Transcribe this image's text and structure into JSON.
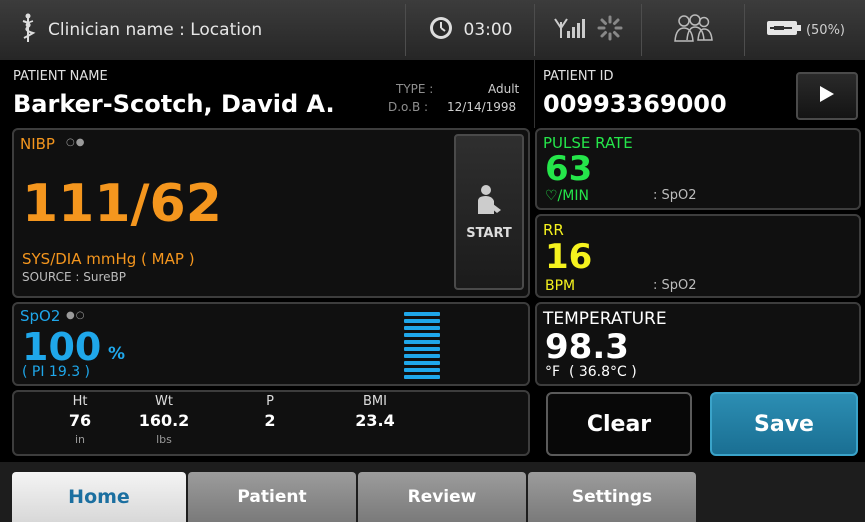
{
  "status_bar": {
    "clinician_location": "Clinician name : Location",
    "time": "03:00",
    "battery_percent": "(50%)",
    "icons": [
      "caduceus-icon",
      "clock-icon",
      "signal-icon",
      "sync-icon",
      "users-icon",
      "battery-icon"
    ]
  },
  "patient": {
    "name_label": "PATIENT NAME",
    "name": "Barker-Scotch, David A.",
    "type_label": "TYPE :",
    "type": "Adult",
    "dob_label": "D.o.B :",
    "dob": "12/14/1998",
    "id_label": "PATIENT ID",
    "id": "00993369000"
  },
  "nibp": {
    "label": "NIBP",
    "value": "111/62",
    "units": "SYS/DIA mmHg ( MAP )",
    "source": "SOURCE : SureBP",
    "start_label": "START",
    "color": "#f4961e"
  },
  "spo2": {
    "label": "SpO2",
    "value": "100",
    "unit": "%",
    "pi": "( PI 19.3 )",
    "signal_bars": 10,
    "color": "#1fa7ea"
  },
  "pulse": {
    "label": "PULSE RATE",
    "value": "63",
    "unit": "♡/MIN",
    "source": ": SpO2",
    "color": "#25e64a"
  },
  "rr": {
    "label": "RR",
    "value": "16",
    "unit": "BPM",
    "source": ": SpO2",
    "color": "#f5f21e"
  },
  "temperature": {
    "label": "TEMPERATURE",
    "value": "98.3",
    "unit": "°F  ( 36.8°C )"
  },
  "manual": {
    "ht_label": "Ht",
    "ht": "76",
    "ht_unit": "in",
    "wt_label": "Wt",
    "wt": "160.2",
    "wt_unit": "lbs",
    "p_label": "P",
    "p": "2",
    "bmi_label": "BMI",
    "bmi": "23.4"
  },
  "actions": {
    "clear": "Clear",
    "save": "Save"
  },
  "tabs": [
    "Home",
    "Patient",
    "Review",
    "Settings"
  ]
}
